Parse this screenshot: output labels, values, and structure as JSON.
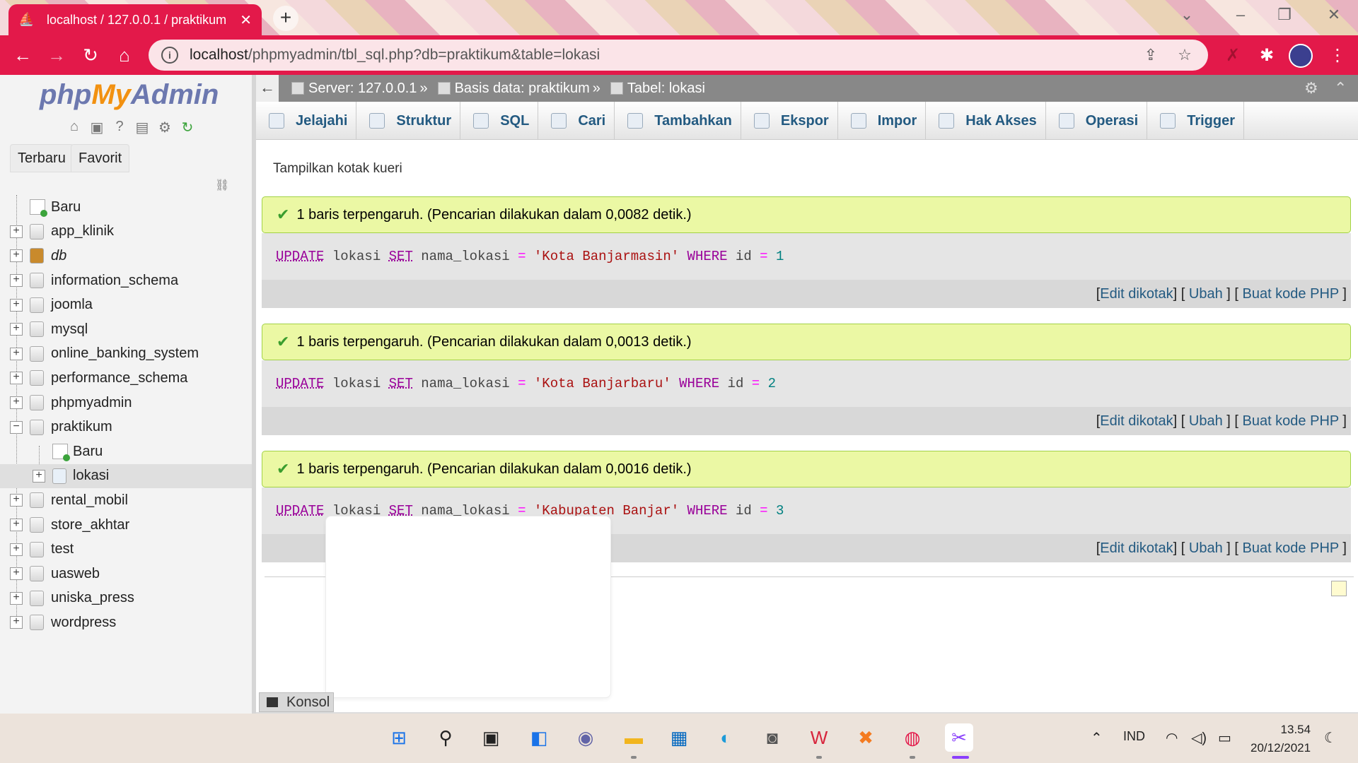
{
  "browser": {
    "tab_title": "localhost / 127.0.0.1 / praktikum",
    "tab_close": "✕",
    "new_tab": "+",
    "url_host": "localhost",
    "url_rest": "/phpmyadmin/tbl_sql.php?db=praktikum&table=lokasi",
    "accent": "#e3194a"
  },
  "pma": {
    "logo": {
      "php": "php",
      "my": "My",
      "admin": "Admin"
    },
    "nav_tabs": [
      "Terbaru",
      "Favorit"
    ],
    "tree": {
      "new_label": "Baru",
      "databases": [
        "app_klinik",
        "db",
        "information_schema",
        "joomla",
        "mysql",
        "online_banking_system",
        "performance_schema",
        "phpmyadmin",
        "praktikum"
      ],
      "praktikum_children": [
        "Baru",
        "lokasi"
      ],
      "databases_after": [
        "rental_mobil",
        "store_akhtar",
        "test",
        "uasweb",
        "uniska_press",
        "wordpress"
      ]
    },
    "breadcrumb": {
      "server": "Server: 127.0.0.1",
      "database": "Basis data: praktikum",
      "table": "Tabel: lokasi",
      "separator": "»"
    },
    "menu_tabs": [
      "Jelajahi",
      "Struktur",
      "SQL",
      "Cari",
      "Tambahkan",
      "Ekspor",
      "Impor",
      "Hak Akses",
      "Operasi",
      "Trigger"
    ],
    "show_query_box": "Tampilkan kotak kueri",
    "results": [
      {
        "message": "1 baris terpengaruh. (Pencarian dilakukan dalam 0,0082 detik.)",
        "sql": {
          "update": "UPDATE",
          "table": " lokasi ",
          "set": "SET",
          "col": " nama_lokasi ",
          "eq": "=",
          "value": " 'Kota Banjarmasin' ",
          "where": "WHERE",
          "idcol": " id ",
          "eq2": "=",
          "id": " 1"
        }
      },
      {
        "message": "1 baris terpengaruh. (Pencarian dilakukan dalam 0,0013 detik.)",
        "sql": {
          "update": "UPDATE",
          "table": " lokasi ",
          "set": "SET",
          "col": " nama_lokasi ",
          "eq": "=",
          "value": " 'Kota Banjarbaru' ",
          "where": "WHERE",
          "idcol": " id ",
          "eq2": "=",
          "id": " 2"
        }
      },
      {
        "message": "1 baris terpengaruh. (Pencarian dilakukan dalam 0,0016 detik.)",
        "sql": {
          "update": "UPDATE",
          "table": " lokasi ",
          "set": "SET",
          "col": " nama_lokasi ",
          "eq": "=",
          "value": " 'Kabupaten Banjar' ",
          "where": "WHERE",
          "idcol": " id ",
          "eq2": "=",
          "id": " 3"
        }
      }
    ],
    "tools": {
      "edit_inline": "Edit dikotak",
      "edit": "Ubah",
      "php_code": "Buat kode PHP"
    },
    "console": "Konsol"
  },
  "taskbar": {
    "lang": "IND",
    "time": "13.54",
    "date": "20/12/2021"
  }
}
